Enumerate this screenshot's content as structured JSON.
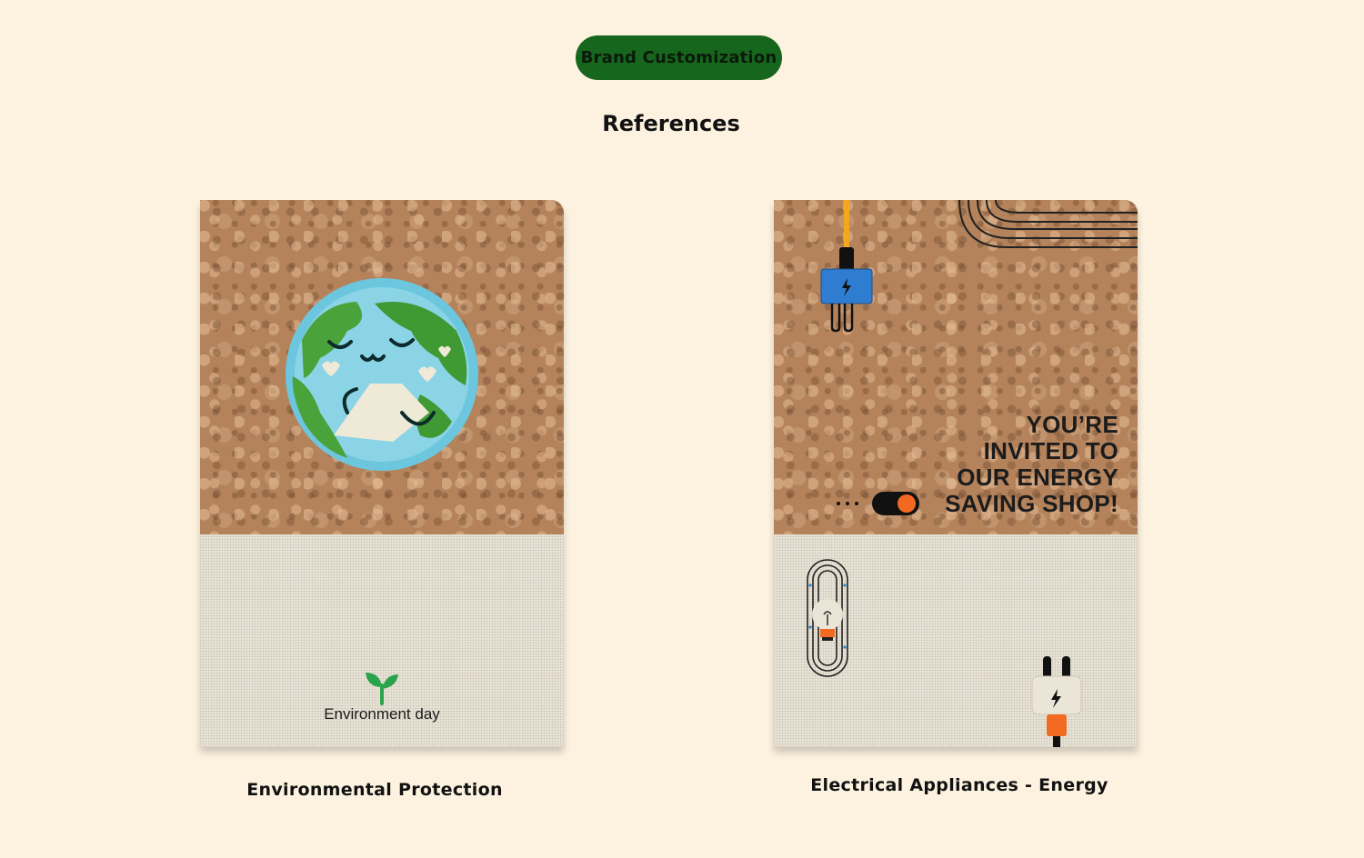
{
  "header": {
    "badge_label": "Brand Customization",
    "title": "References"
  },
  "cards": [
    {
      "artwork_text": "Environment day",
      "caption": "Environmental Protection"
    },
    {
      "artwork_lines": [
        "YOU’RE",
        "INVITED TO",
        "OUR ENERGY",
        "SAVING SHOP!"
      ],
      "caption": "Electrical Appliances - Energy"
    }
  ],
  "icons": [
    "earth-hug-icon",
    "sprout-icon",
    "blue-plug-icon",
    "toggle-switch-icon",
    "light-bulb-icon",
    "white-plug-icon",
    "concentric-lines-icon"
  ],
  "colors": {
    "background": "#fdf2e0",
    "badge": "#17661d",
    "cork": "#b4835c",
    "linen": "#e9e4d8",
    "accent_orange": "#f26a21",
    "accent_blue": "#2f7dd1"
  }
}
